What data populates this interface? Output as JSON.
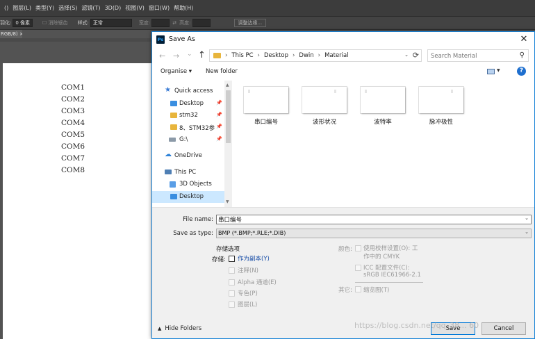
{
  "ps_menu": [
    "()",
    "图层(L)",
    "类型(Y)",
    "选择(S)",
    "滤镜(T)",
    "3D(D)",
    "视图(V)",
    "窗口(W)",
    "帮助(H)"
  ],
  "ps_options": {
    "feather_label": "羽化:",
    "feather_value": "0 像素",
    "antialias": "消除锯齿",
    "style_label": "样式:",
    "style_value": "正常",
    "width_label": "宽度:",
    "height_label": "高度:",
    "refine_button": "调整边缘..."
  },
  "ps_doc_tab": "RGB/8) ×",
  "canvas_text": [
    "COM1",
    "COM2",
    "COM3",
    "COM4",
    "COM5",
    "COM6",
    "COM7",
    "COM8"
  ],
  "dialog": {
    "app_icon": "Ps",
    "title": "Save As",
    "close_icon": "✕",
    "nav": {
      "back": "←",
      "forward": "→",
      "recent": "⌄",
      "up": "↑"
    },
    "breadcrumb": [
      "This PC",
      "Desktop",
      "Dwin",
      "Material"
    ],
    "breadcrumb_sep": "›",
    "search_placeholder": "Search Material",
    "toolbar": {
      "organise": "Organise ▾",
      "new_folder": "New folder",
      "help": "?"
    },
    "nav_pane": [
      {
        "label": "Quick access",
        "icon": "star-icon"
      },
      {
        "label": "Desktop",
        "icon": "folder-icon",
        "pinned": true
      },
      {
        "label": "stm32",
        "icon": "folder-icon",
        "pinned": true
      },
      {
        "label": "8、STM32参",
        "icon": "folder-icon",
        "pinned": true
      },
      {
        "label": "G:\\",
        "icon": "drive-icon",
        "pinned": true
      },
      {
        "label": "OneDrive",
        "icon": "cloud-icon"
      },
      {
        "label": "This PC",
        "icon": "pc-icon"
      },
      {
        "label": "3D Objects",
        "icon": "cube-icon"
      },
      {
        "label": "Desktop",
        "icon": "folder-icon",
        "selected": true
      }
    ],
    "files": [
      "串口编号",
      "波形状况",
      "波特率",
      "脉冲极性"
    ],
    "form": {
      "filename_label": "File name:",
      "filename_value": "串口编号",
      "type_label": "Save as type:",
      "type_value": "BMP (*.BMP;*.RLE;*.DIB)"
    },
    "options": {
      "section_title": "存储选项",
      "store_label": "存储:",
      "as_copy": "作为副本(Y)",
      "notes": "注释(N)",
      "alpha": "Alpha 通道(E)",
      "spot": "专色(P)",
      "layers": "图层(L)",
      "color_label": "颜色:",
      "use_proof_1": "使用校样设置(O): 工",
      "use_proof_2": "作中的 CMYK",
      "icc_1": "ICC 配置文件(C):",
      "icc_2": "sRGB IEC61966-2.1",
      "other_label": "其它:",
      "thumbnail": "缩览图(T)"
    },
    "bottom": {
      "hide_folders": "Hide Folders",
      "save": "Save",
      "cancel": "Cancel"
    }
  },
  "watermark": "https://blog.csdn.net/qq_38... 60"
}
